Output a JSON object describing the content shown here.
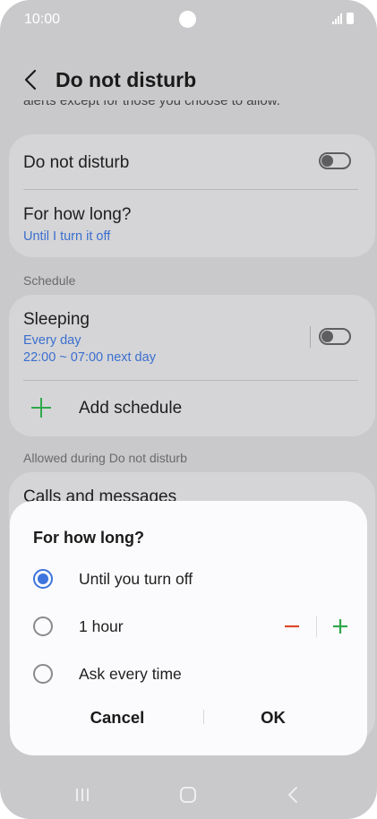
{
  "status": {
    "time": "10:00"
  },
  "header": {
    "title": "Do not disturb",
    "cut_text": "alerts except for those you choose to allow."
  },
  "main": {
    "dnd_label": "Do not disturb",
    "how_long_label": "For how long?",
    "how_long_value": "Until I turn it off",
    "schedule_header": "Schedule",
    "sleeping_label": "Sleeping",
    "sleeping_days": "Every day",
    "sleeping_time": "22:00 ~ 07:00 next day",
    "add_schedule": "Add schedule",
    "allowed_header": "Allowed during Do not disturb",
    "calls_messages": "Calls and messages"
  },
  "dialog": {
    "title": "For how long?",
    "options": [
      {
        "label": "Until you turn off",
        "selected": true
      },
      {
        "label": "1 hour",
        "selected": false
      },
      {
        "label": "Ask every time",
        "selected": false
      }
    ],
    "cancel": "Cancel",
    "ok": "OK"
  },
  "colors": {
    "accent": "#3e74dd",
    "minus": "#e0482b",
    "plus": "#2fa84a",
    "link": "#3b6fcf"
  },
  "icons": {
    "back": "chevron-left-icon",
    "add": "plus-icon",
    "decrease": "minus-icon",
    "increase": "plus-icon",
    "nav_recents": "recents-icon",
    "nav_home": "home-icon",
    "nav_back": "back-icon"
  }
}
